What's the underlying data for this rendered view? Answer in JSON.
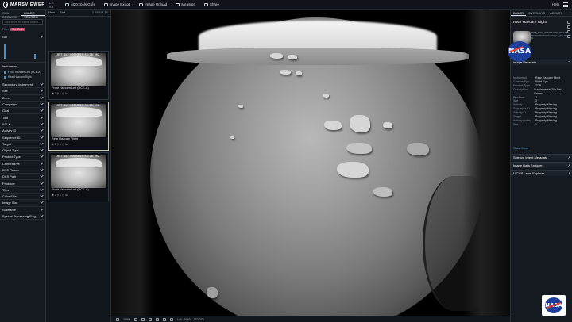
{
  "app": {
    "name": "MARSVIEWER",
    "version": "CR 9.1"
  },
  "topnav": [
    {
      "label": "M20: Sols Gols"
    },
    {
      "label": "Image Export"
    },
    {
      "label": "Image Upload"
    },
    {
      "label": "Measure"
    },
    {
      "label": "Share"
    }
  ],
  "help": "Help",
  "left": {
    "tabs": [
      "SOL BROWSE",
      "IMAGE SEARCH"
    ],
    "search_placeholder": "Search by filename or text",
    "filter_label": "Filter",
    "chip": "Sol: Both",
    "sol_label": "Sol",
    "instrument_label": "Instrument",
    "instrument_options": [
      "Front Hazcam Left (RCE-A)",
      "Rear Hazcam Right"
    ],
    "filters": [
      "Secondary Instrument",
      "Site",
      "Drive",
      "Campaign",
      "Goal",
      "Tool",
      "SCLK",
      "Activity ID",
      "Sequence ID",
      "Target",
      "Object Type",
      "Product Type",
      "Camera Eye",
      "RCE Owner",
      "DCS Path",
      "Producer",
      "Tiles",
      "Color Filter",
      "Image Size",
      "Subframe",
      "Special Processing Flag"
    ]
  },
  "thumbs": {
    "view_label": "View",
    "sort_label": "Sort",
    "count": "3 RESULTS",
    "cards": [
      {
        "ts": "LMST Sol 00000M15:53:38.002",
        "caption": "Front Hazcam Left (RCE-A)",
        "meta": "✱ 3   ⚲ 1   ◷ 4d"
      },
      {
        "ts": "LMST Sol 00000M15:53:38.002",
        "caption": "Rear Hazcam Right",
        "meta": "✱ 3   ⚲ 1   ◷ 4d"
      },
      {
        "ts": "LMST Sol 00000M15:53:38.002",
        "caption": "Front Hazcam Left (RCE-A)",
        "meta": "✱ 3   ⚲ 1   ◷ 4d"
      }
    ]
  },
  "viewer": {
    "zoom": "100%",
    "coords": "L/S : 57401, 270.238"
  },
  "right": {
    "tabs": [
      "IMAGE",
      "OVERLAYS",
      "ADJUST"
    ],
    "title": "Rear Hazcam Right",
    "filename": "RRB_0000_0666952079_000ECM_N0000000000000000_01_0LLJ01.IMG",
    "metadata_header": "Image Metadata",
    "metadata": [
      {
        "k": "Instrument",
        "v": "Rear Hazcam Right"
      },
      {
        "k": "Camera Eye",
        "v": "Right Eye"
      },
      {
        "k": "Product Type",
        "v": "TDR"
      },
      {
        "k": "Description",
        "v": "Fundamental Tile Data Record"
      },
      {
        "k": "Producer",
        "v": "J"
      },
      {
        "k": "Site",
        "v": "3"
      },
      {
        "k": "Activity",
        "v": "Property Missing"
      },
      {
        "k": "Sequence ID",
        "v": "Property Missing"
      },
      {
        "k": "Activity ID",
        "v": "Property Missing"
      },
      {
        "k": "Target",
        "v": "Property Missing"
      },
      {
        "k": "Activity Notes",
        "v": "Property Missing"
      },
      {
        "k": "Site",
        "v": "1"
      }
    ],
    "show_more": "Show More",
    "sections": [
      "Science Intent Metadata",
      "Image Data Explorer",
      "VICAR Label Explorer"
    ]
  },
  "logo_text": "NASA"
}
